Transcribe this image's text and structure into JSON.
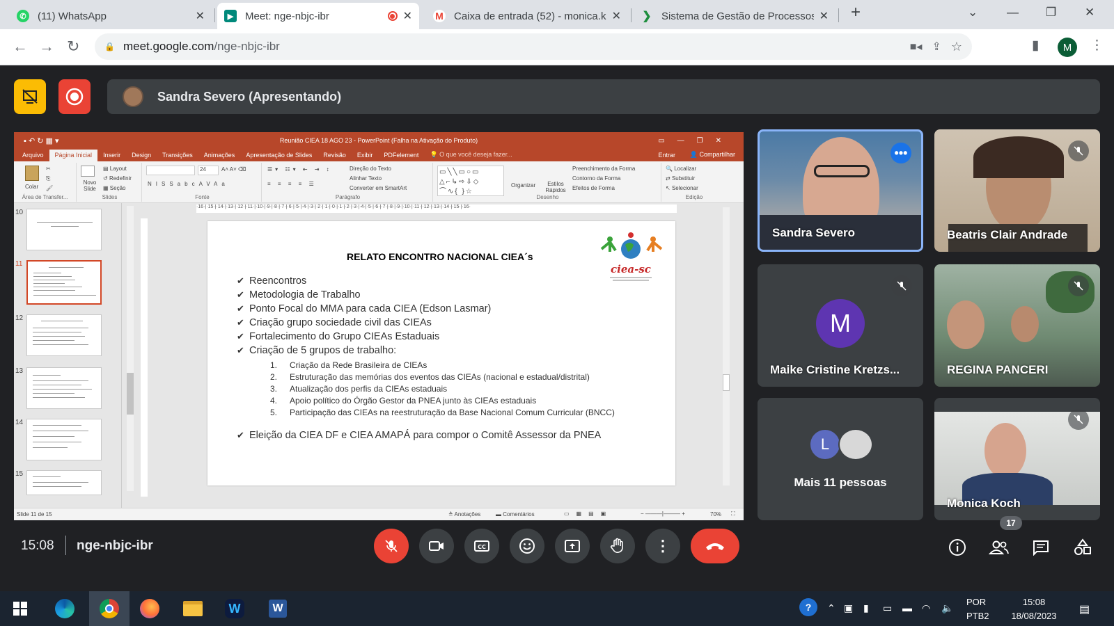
{
  "browser": {
    "tabs": [
      {
        "title": "(11) WhatsApp",
        "icon": "whatsapp-icon",
        "color": "#25d366"
      },
      {
        "title": "Meet: nge-nbjc-ibr",
        "icon": "google-meet-icon",
        "color": "#00897b"
      },
      {
        "title": "Caixa de entrada (52) - monica.k",
        "icon": "gmail-icon",
        "color": "#ea4335"
      },
      {
        "title": "Sistema de Gestão de Processos",
        "icon": "sgp-icon",
        "color": "#1e8e3e"
      }
    ],
    "new_tab": "+",
    "url_host": "meet.google.com",
    "url_path": "/nge-nbjc-ibr",
    "profile_initial": "M"
  },
  "meet": {
    "presenter_label": "Sandra Severo (Apresentando)",
    "clock": "15:08",
    "meeting_code": "nge-nbjc-ibr",
    "people_count": "17",
    "end_call_color": "#ea4335",
    "participants": [
      {
        "name": "Sandra Severo"
      },
      {
        "name": "Beatris Clair Andrade"
      },
      {
        "name": "Maike Cristine Kretzs...",
        "initial": "M",
        "avatar_color": "#5e35b1"
      },
      {
        "name": "REGINA PANCERI"
      },
      {
        "name": "Mais 11 pessoas",
        "initial": "L",
        "avatar_color": "#5c6bc0"
      },
      {
        "name": "Monica Koch"
      }
    ]
  },
  "ppt": {
    "window_title": "Reunião CIEA 18 AGO 23 - PowerPoint (Falha na Ativação do Produto)",
    "menu": [
      "Arquivo",
      "Página Inicial",
      "Inserir",
      "Design",
      "Transições",
      "Animações",
      "Apresentação de Slides",
      "Revisão",
      "Exibir",
      "PDFelement"
    ],
    "tell_me": "O que você deseja fazer...",
    "sign_in": "Entrar",
    "share": "Compartilhar",
    "ribbon": {
      "paste": "Colar",
      "clipboard": "Área de Transfer...",
      "new_slide": "Novo Slide",
      "layout": "Layout",
      "reset": "Redefinir",
      "section": "Seção",
      "slides": "Slides",
      "font_size": "24",
      "font": "Fonte",
      "text_direction": "Direção do Texto",
      "align_text": "Alinhar Texto",
      "smartart": "Converter em SmartArt",
      "paragraph": "Parágrafo",
      "arrange": "Organizar",
      "quick_styles": "Estilos Rápidos",
      "shape_fill": "Preenchimento da Forma",
      "shape_outline": "Contorno da Forma",
      "shape_effects": "Efeitos de Forma",
      "drawing": "Desenho",
      "find": "Localizar",
      "replace": "Substituir",
      "select": "Selecionar",
      "editing": "Edição"
    },
    "thumb_numbers": [
      "10",
      "11",
      "12",
      "13",
      "14",
      "15"
    ],
    "hruler": "·16·|·15·|·14·|·13·|·12·|·11·|·10·|·9·|·8·|·7·|·6·|·5·|·4·|·3·|·2·|·1·|·0·|·1·|·2·|·3·|·4·|·5·|·6·|·7·|·8·|·9·|·10·|·11·|·12·|·13·|·14·|·15·|·16·",
    "slide": {
      "title": "RELATO ENCONTRO NACIONAL CIEA´s",
      "bullets": [
        "Reencontros",
        "Metodologia de Trabalho",
        "Ponto Focal do MMA para cada CIEA (Edson Lasmar)",
        "Criação grupo sociedade civil das CIEAs",
        "Fortalecimento do Grupo CIEAs Estaduais",
        "Criação de 5 grupos de trabalho:"
      ],
      "subitems": [
        {
          "n": "1.",
          "t": "Criação da Rede Brasileira de CIEAs"
        },
        {
          "n": "2.",
          "t": "Estruturação das memórias dos eventos das CIEAs (nacional e estadual/distrital)"
        },
        {
          "n": "3.",
          "t": "Atualização dos perfis da CIEAs estaduais"
        },
        {
          "n": "4.",
          "t": "Apoio  político do Órgão Gestor da PNEA junto às CIEAs estaduais"
        },
        {
          "n": "5.",
          "t": "Participação das CIEAs na reestruturação da Base Nacional Comum Curricular (BNCC)"
        }
      ],
      "last_bullet": "Eleição da CIEA DF e CIEA AMAPÁ para compor o Comitê Assessor da PNEA",
      "logo_text": "ciea-sc"
    },
    "status": {
      "slide_counter": "Slide 11 de 15",
      "notes": "Anotações",
      "comments": "Comentários",
      "zoom": "70%"
    }
  },
  "taskbar": {
    "language": "POR",
    "layout": "PTB2",
    "time": "15:08",
    "date": "18/08/2023"
  }
}
